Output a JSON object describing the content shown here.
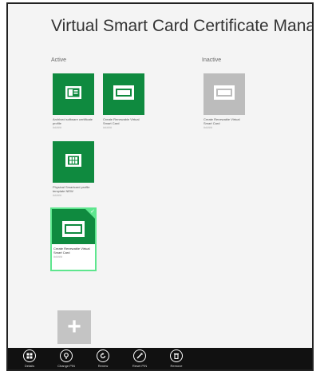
{
  "app": {
    "title": "Virtual Smart Card Certificate Manager"
  },
  "sections": {
    "active_label": "Active",
    "inactive_label": "Inactive"
  },
  "tiles": [
    {
      "caption": "Archived software certificate profile",
      "sub": "#####",
      "icon": "id-card-icon",
      "state": "active"
    },
    {
      "caption": "Create Renewable Virtual Smart Card",
      "sub": "#####",
      "icon": "smart-card-icon",
      "state": "active"
    },
    {
      "caption": "Physical Smartcard profile template NEW",
      "sub": "#####",
      "icon": "chip-icon",
      "state": "active"
    },
    {
      "caption": "Create Renewable Virtual Smart Card",
      "sub": "#####",
      "icon": "smart-card-icon",
      "state": "active-selected"
    },
    {
      "caption": "Create Renewable Virtual Smart Card",
      "sub": "#####",
      "icon": "smart-card-icon",
      "state": "inactive"
    }
  ],
  "add_tile": {
    "label": "+"
  },
  "appbar": [
    {
      "label": "Details",
      "icon": "details-icon"
    },
    {
      "label": "Change PIN",
      "icon": "change-pin-icon"
    },
    {
      "label": "Renew",
      "icon": "renew-icon"
    },
    {
      "label": "Reset PIN",
      "icon": "reset-pin-icon"
    },
    {
      "label": "Remove",
      "icon": "remove-icon"
    }
  ],
  "colors": {
    "tile_green": "#0f8a3f",
    "tile_gray": "#bcbcbc",
    "selected_border": "#5ee68e",
    "appbar_bg": "#111111"
  }
}
